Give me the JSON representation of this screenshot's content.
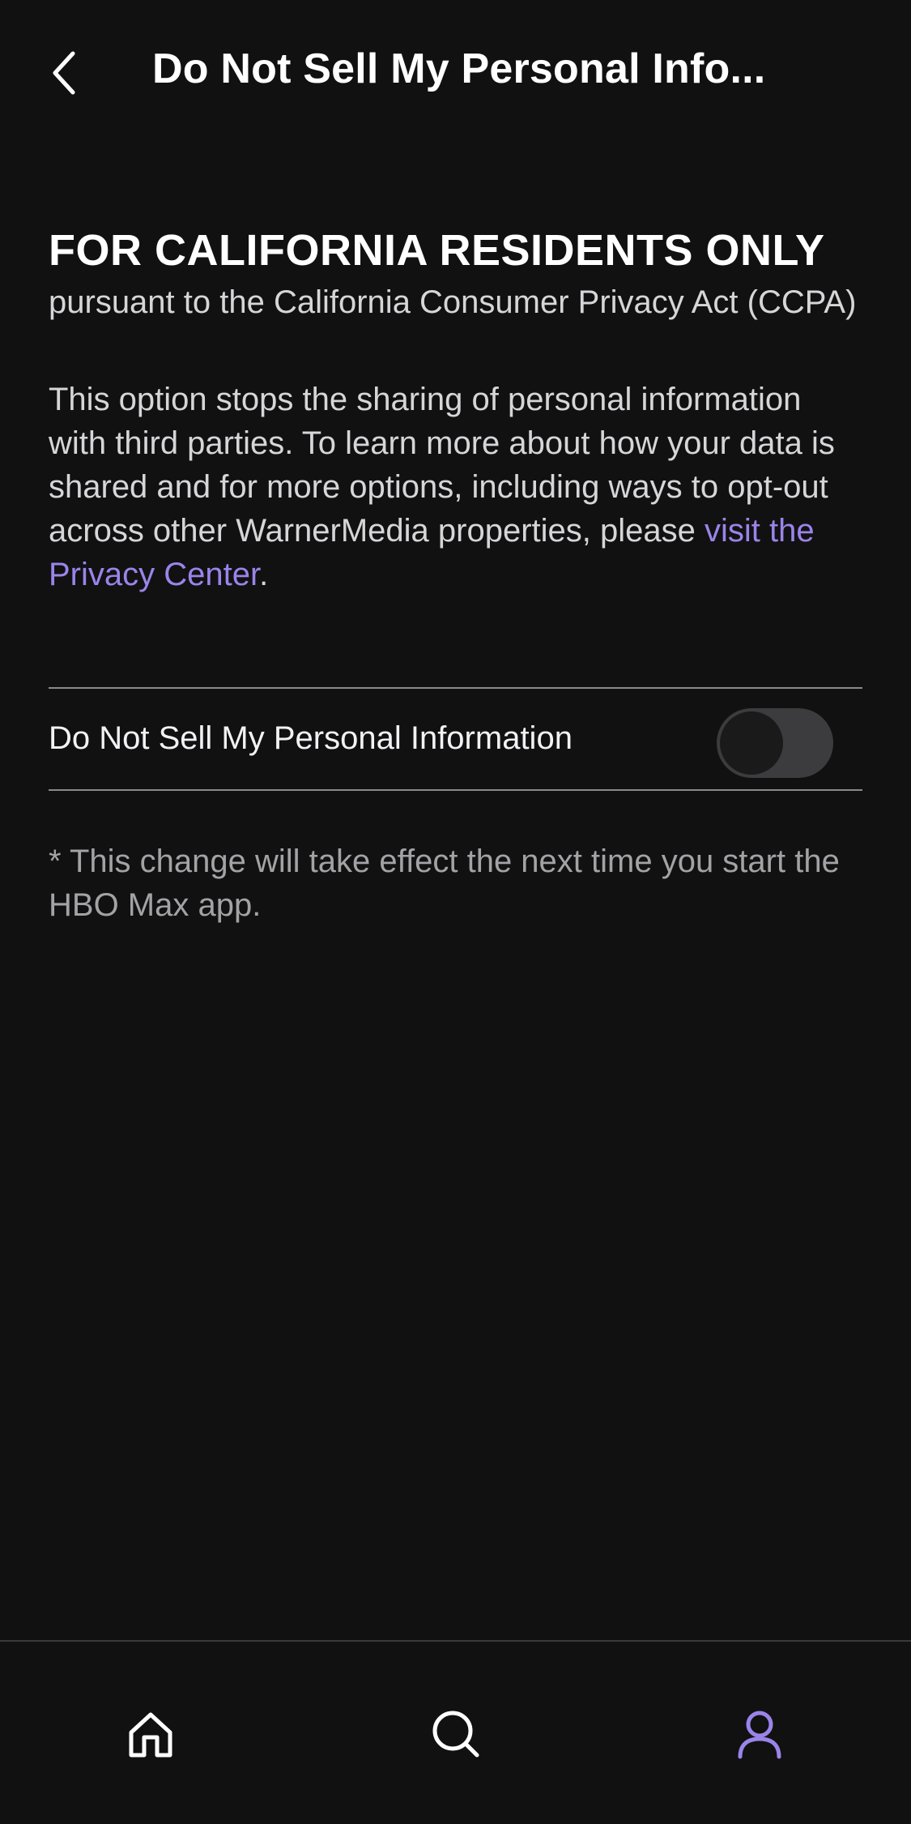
{
  "header": {
    "title": "Do Not Sell My Personal Info...",
    "back_icon": "chevron-left-icon"
  },
  "main": {
    "heading": "FOR CALIFORNIA RESIDENTS ONLY",
    "subheading": "pursuant to the California Consumer Privacy Act (CCPA)",
    "description_text": "This option stops the sharing of personal information with third parties. To learn more about how your data is shared and for more options, including ways to opt-out across other WarnerMedia properties, please ",
    "privacy_link_text": "visit the Privacy Center",
    "description_end": ".",
    "toggle": {
      "label": "Do Not Sell My Personal Information",
      "state": "off"
    },
    "footnote": "* This change will take effect the next time you start the HBO Max app."
  },
  "bottom_nav": {
    "items": [
      {
        "icon": "home-icon",
        "active": false
      },
      {
        "icon": "search-icon",
        "active": false
      },
      {
        "icon": "profile-icon",
        "active": true
      }
    ]
  },
  "colors": {
    "background": "#111112",
    "accent": "#9b84e9",
    "text": "#ffffff",
    "muted_text": "#a3a3a6",
    "divider": "#8a8a8e"
  }
}
